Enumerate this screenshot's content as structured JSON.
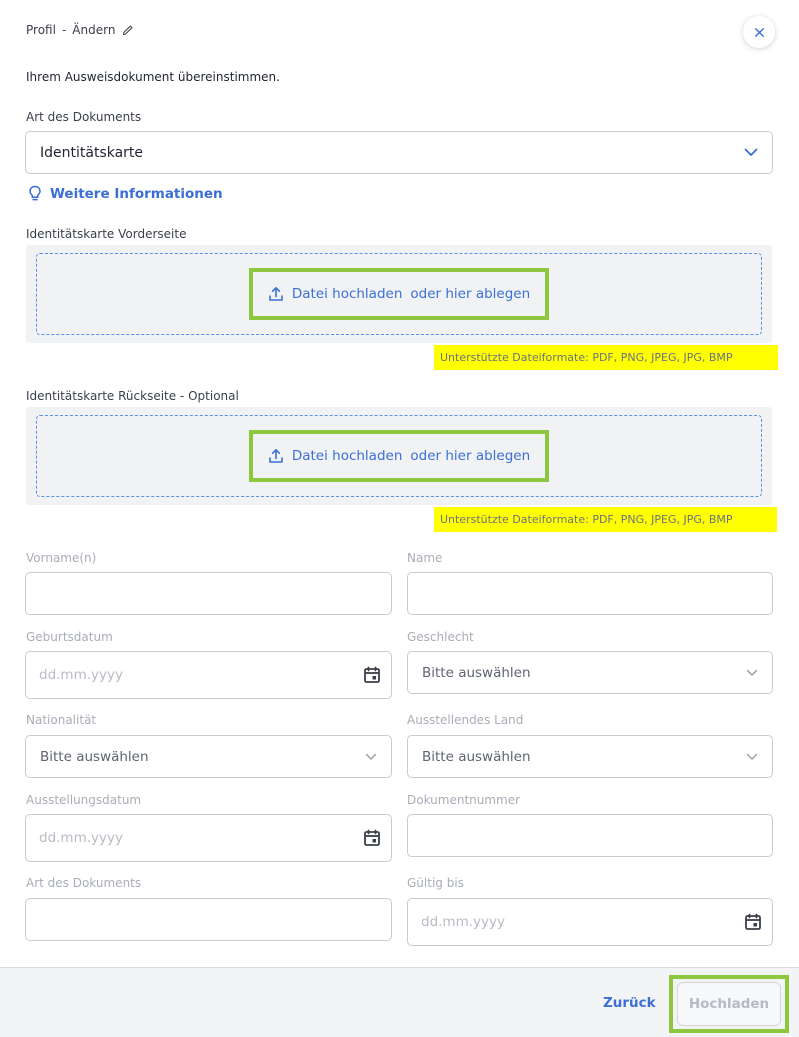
{
  "header": {
    "breadcrumb_section": "Profil",
    "breadcrumb_separator": "-",
    "breadcrumb_action": "Ändern"
  },
  "intro_text": "Ihrem Ausweisdokument übereinstimmen.",
  "document_type": {
    "label": "Art des Dokuments",
    "value": "Identitätskarte"
  },
  "info_link": "Weitere Informationen",
  "front_upload": {
    "label": "Identitätskarte Vorderseite",
    "upload_text": "Datei hochladen",
    "drop_text": "oder hier ablegen",
    "formats": "Unterstützte Dateiformate: PDF, PNG, JPEG, JPG, BMP"
  },
  "back_upload": {
    "label": "Identitätskarte Rückseite - Optional",
    "upload_text": "Datei hochladen",
    "drop_text": "oder hier ablegen",
    "formats": "Unterstützte Dateiformate: PDF, PNG, JPEG, JPG, BMP"
  },
  "fields": {
    "firstname_label": "Vorname(n)",
    "lastname_label": "Name",
    "birthdate_label": "Geburtsdatum",
    "birthdate_placeholder": "dd.mm.yyyy",
    "gender_label": "Geschlecht",
    "gender_value": "Bitte auswählen",
    "nationality_label": "Nationalität",
    "nationality_value": "Bitte auswählen",
    "issuing_country_label": "Ausstellendes Land",
    "issuing_country_value": "Bitte auswählen",
    "issue_date_label": "Ausstellungsdatum",
    "issue_date_placeholder": "dd.mm.yyyy",
    "document_number_label": "Dokumentnummer",
    "doc_type_label": "Art des Dokuments",
    "valid_until_label": "Gültig bis",
    "valid_until_placeholder": "dd.mm.yyyy"
  },
  "footer": {
    "back_label": "Zurück",
    "submit_label": "Hochladen"
  },
  "colors": {
    "accent": "#3b6fd6",
    "highlight_green": "#8dc63f",
    "highlight_yellow": "#ffff00"
  }
}
